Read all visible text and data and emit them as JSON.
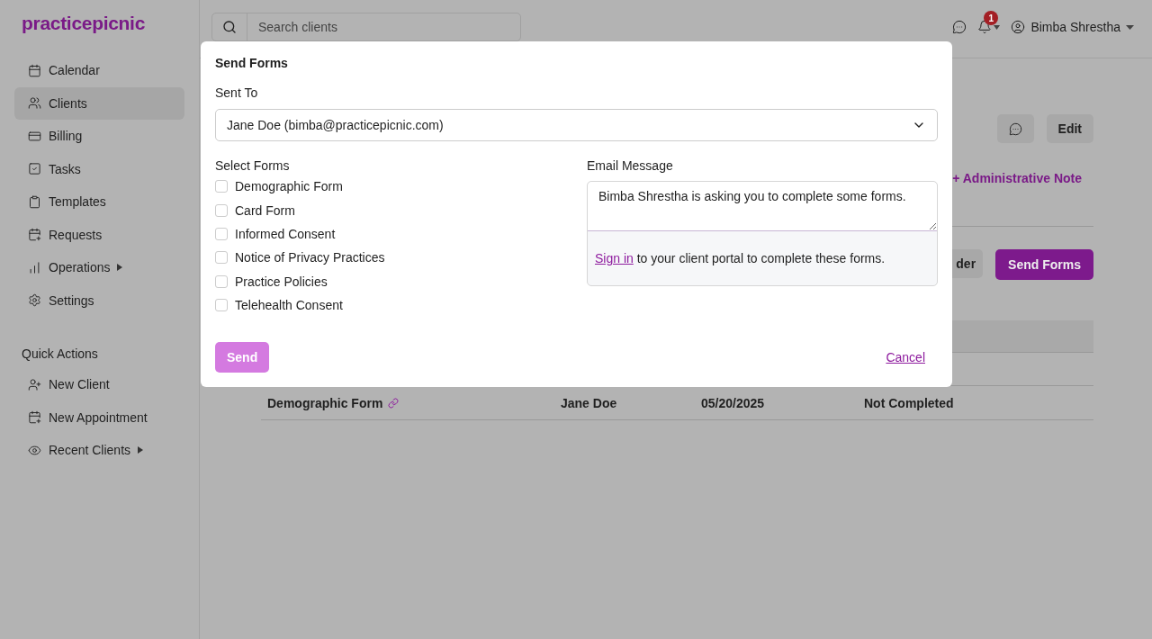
{
  "app": {
    "logo": "practicepicnic"
  },
  "sidebar": {
    "items": [
      {
        "label": "Calendar",
        "selected": false,
        "has_submenu": false
      },
      {
        "label": "Clients",
        "selected": true,
        "has_submenu": false
      },
      {
        "label": "Billing",
        "selected": false,
        "has_submenu": false
      },
      {
        "label": "Tasks",
        "selected": false,
        "has_submenu": false
      },
      {
        "label": "Templates",
        "selected": false,
        "has_submenu": false
      },
      {
        "label": "Requests",
        "selected": false,
        "has_submenu": false
      },
      {
        "label": "Operations",
        "selected": false,
        "has_submenu": true
      },
      {
        "label": "Settings",
        "selected": false,
        "has_submenu": false
      }
    ],
    "quick_actions_title": "Quick Actions",
    "quick_actions": [
      {
        "label": "New Client",
        "has_submenu": false
      },
      {
        "label": "New Appointment",
        "has_submenu": false
      },
      {
        "label": "Recent Clients",
        "has_submenu": true
      }
    ]
  },
  "header": {
    "search": {
      "placeholder": "Search clients"
    },
    "notification_count": "1",
    "user_name": "Bimba Shrestha"
  },
  "page": {
    "edit_button": "Edit",
    "admin_note_link": "+ Administrative Note",
    "partial_button": "der",
    "send_forms_button": "Send Forms",
    "table": {
      "rows": [
        {
          "form": "Demographic Form",
          "client": "Jane Doe",
          "date": "05/20/2025",
          "status": "Not Completed"
        }
      ]
    }
  },
  "dialog": {
    "title": "Send Forms",
    "sent_to_label": "Sent To",
    "sent_to_value": "Jane Doe (bimba@practicepicnic.com)",
    "select_forms_label": "Select Forms",
    "forms": [
      {
        "label": "Demographic Form",
        "checked": false
      },
      {
        "label": "Card Form",
        "checked": false
      },
      {
        "label": "Informed Consent",
        "checked": false
      },
      {
        "label": "Notice of Privacy Practices",
        "checked": false
      },
      {
        "label": "Practice Policies",
        "checked": false
      },
      {
        "label": "Telehealth Consent",
        "checked": false
      }
    ],
    "email_label": "Email Message",
    "email_message": "Bimba Shrestha is asking you to complete some forms.",
    "footer_link": "Sign in",
    "footer_text": "to your client portal to complete these forms.",
    "send_button": {
      "label": "Send",
      "disabled": true
    },
    "cancel_link": "Cancel"
  }
}
